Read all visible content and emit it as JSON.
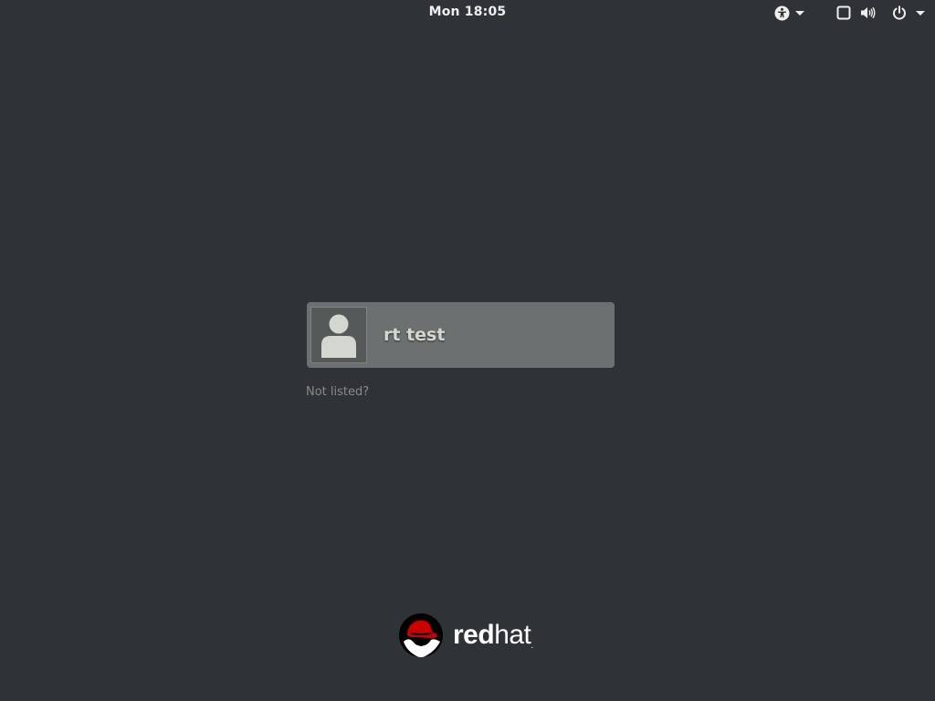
{
  "top_bar": {
    "clock": "Mon 18:05",
    "accessibility_icon": "accessibility-icon",
    "screen_icon": "display-icon",
    "volume_icon": "volume-icon",
    "power_icon": "power-icon"
  },
  "users": [
    {
      "name": "rt test",
      "avatar_icon": "user-avatar-icon"
    }
  ],
  "not_listed_label": "Not listed?",
  "logo": {
    "part1": "red",
    "part2": "hat",
    "trademark": ".",
    "colors": {
      "red": "#cc0000",
      "white": "#ffffff",
      "black": "#000000"
    }
  },
  "colors": {
    "background": "#2f3236",
    "user_item": "#6d7071",
    "text": "#eeeeec"
  }
}
